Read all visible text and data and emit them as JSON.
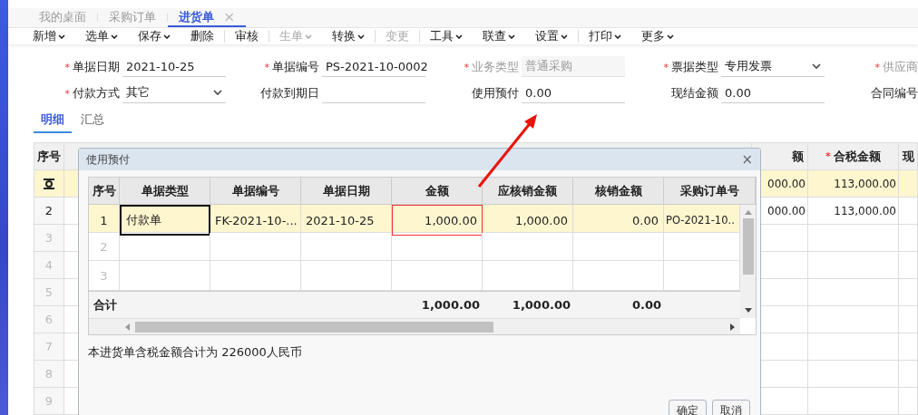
{
  "tabs": [
    {
      "label": "我的桌面",
      "selected": false,
      "closable": false
    },
    {
      "label": "采购订单",
      "selected": false,
      "closable": false
    },
    {
      "label": "进货单",
      "selected": true,
      "closable": true,
      "close": "×"
    }
  ],
  "toolbar": {
    "groups": [
      [
        {
          "label": "新增",
          "dropdown": true,
          "disabled": false
        },
        {
          "label": "选单",
          "dropdown": true,
          "disabled": false
        },
        {
          "label": "保存",
          "dropdown": true,
          "disabled": false
        },
        {
          "label": "删除",
          "dropdown": false,
          "disabled": false
        }
      ],
      [
        {
          "label": "审核",
          "dropdown": false,
          "disabled": false
        }
      ],
      [
        {
          "label": "生单",
          "dropdown": true,
          "disabled": true
        },
        {
          "label": "转换",
          "dropdown": true,
          "disabled": false
        }
      ],
      [
        {
          "label": "变更",
          "dropdown": false,
          "disabled": true
        }
      ],
      [
        {
          "label": "工具",
          "dropdown": true,
          "disabled": false
        },
        {
          "label": "联查",
          "dropdown": true,
          "disabled": false
        },
        {
          "label": "设置",
          "dropdown": true,
          "disabled": false
        }
      ],
      [
        {
          "label": "打印",
          "dropdown": true,
          "disabled": false
        },
        {
          "label": "更多",
          "dropdown": true,
          "disabled": false
        }
      ]
    ]
  },
  "form": {
    "fields": [
      {
        "label": "单据日期",
        "required_mark": "*",
        "disabled": false,
        "kind": "text",
        "value": "2021-10-25"
      },
      {
        "label": "单据编号",
        "required_mark": "*",
        "disabled": false,
        "kind": "text",
        "value": "PS-2021-10-0002"
      },
      {
        "label": "业务类型",
        "required_mark": "*",
        "disabled": true,
        "kind": "text",
        "value": "普通采购"
      },
      {
        "label": "票据类型",
        "required_mark": "*",
        "disabled": false,
        "kind": "select",
        "value": "专用发票"
      },
      {
        "label": "供应商",
        "required_mark": "*",
        "disabled": true,
        "kind": "offscreen"
      },
      {
        "label": "付款方式",
        "required_mark": "*",
        "disabled": false,
        "kind": "select",
        "value": "其它"
      },
      {
        "label": "付款到期日",
        "disabled": false,
        "kind": "text"
      },
      {
        "label": "使用预付",
        "disabled": false,
        "kind": "text",
        "value": "0.00"
      },
      {
        "label": "现结金额",
        "disabled": false,
        "kind": "text",
        "value": "0.00"
      },
      {
        "label": "合同编号",
        "disabled": false,
        "kind": "offscreen"
      }
    ]
  },
  "sub_tabs": [
    {
      "label": "明细",
      "selected": true
    },
    {
      "label": "汇总",
      "selected": false
    }
  ],
  "table": {
    "columns": [
      {
        "label": "序号"
      },
      {
        "label": "额"
      },
      {
        "label": "合税金额",
        "required_mark": "*"
      },
      {
        "label": "现"
      }
    ],
    "rows": [
      {
        "kind": "current",
        "selected": true,
        "cells": [
          "000.00",
          "113,000.00"
        ]
      },
      {
        "kind": "filled",
        "selected": false,
        "number": "2",
        "cells": [
          "000.00",
          "113,000.00"
        ]
      },
      {
        "kind": "blank",
        "selected": false,
        "number": "3"
      },
      {
        "kind": "blank",
        "selected": false,
        "number": "4"
      },
      {
        "kind": "blank",
        "selected": false,
        "number": "5"
      },
      {
        "kind": "blank",
        "selected": false,
        "number": "6"
      },
      {
        "kind": "blank",
        "selected": false,
        "number": "7"
      },
      {
        "kind": "blank",
        "selected": false,
        "number": "8"
      },
      {
        "kind": "blank",
        "selected": false,
        "number": "9"
      }
    ]
  },
  "dialog": {
    "title": "使用预付",
    "close": "×",
    "columns": [
      "序号",
      "单据类型",
      "单据编号",
      "单据日期",
      "金额",
      "应核销金额",
      "核销金额",
      "采购订单号"
    ],
    "rows": [
      {
        "selected": true,
        "annotated": true,
        "cell_focus": [
          false,
          true,
          false,
          false,
          false,
          false,
          false,
          false
        ],
        "cells": [
          "1",
          "付款单",
          "FK-2021-10-...",
          "2021-10-25",
          "1,000.00",
          "1,000.00",
          "0.00",
          "PO-2021-10.."
        ]
      },
      {
        "selected": false,
        "annotated": false,
        "cells": [
          "2"
        ]
      },
      {
        "selected": false,
        "annotated": false,
        "cells": [
          "3"
        ]
      }
    ],
    "totals": {
      "label": "合计",
      "amount": "1,000.00",
      "due_amount": "1,000.00",
      "written_off": "0.00"
    },
    "note": "本进货单含税金额合计为 226000人民币",
    "buttons": [
      "确定",
      "取消"
    ]
  }
}
